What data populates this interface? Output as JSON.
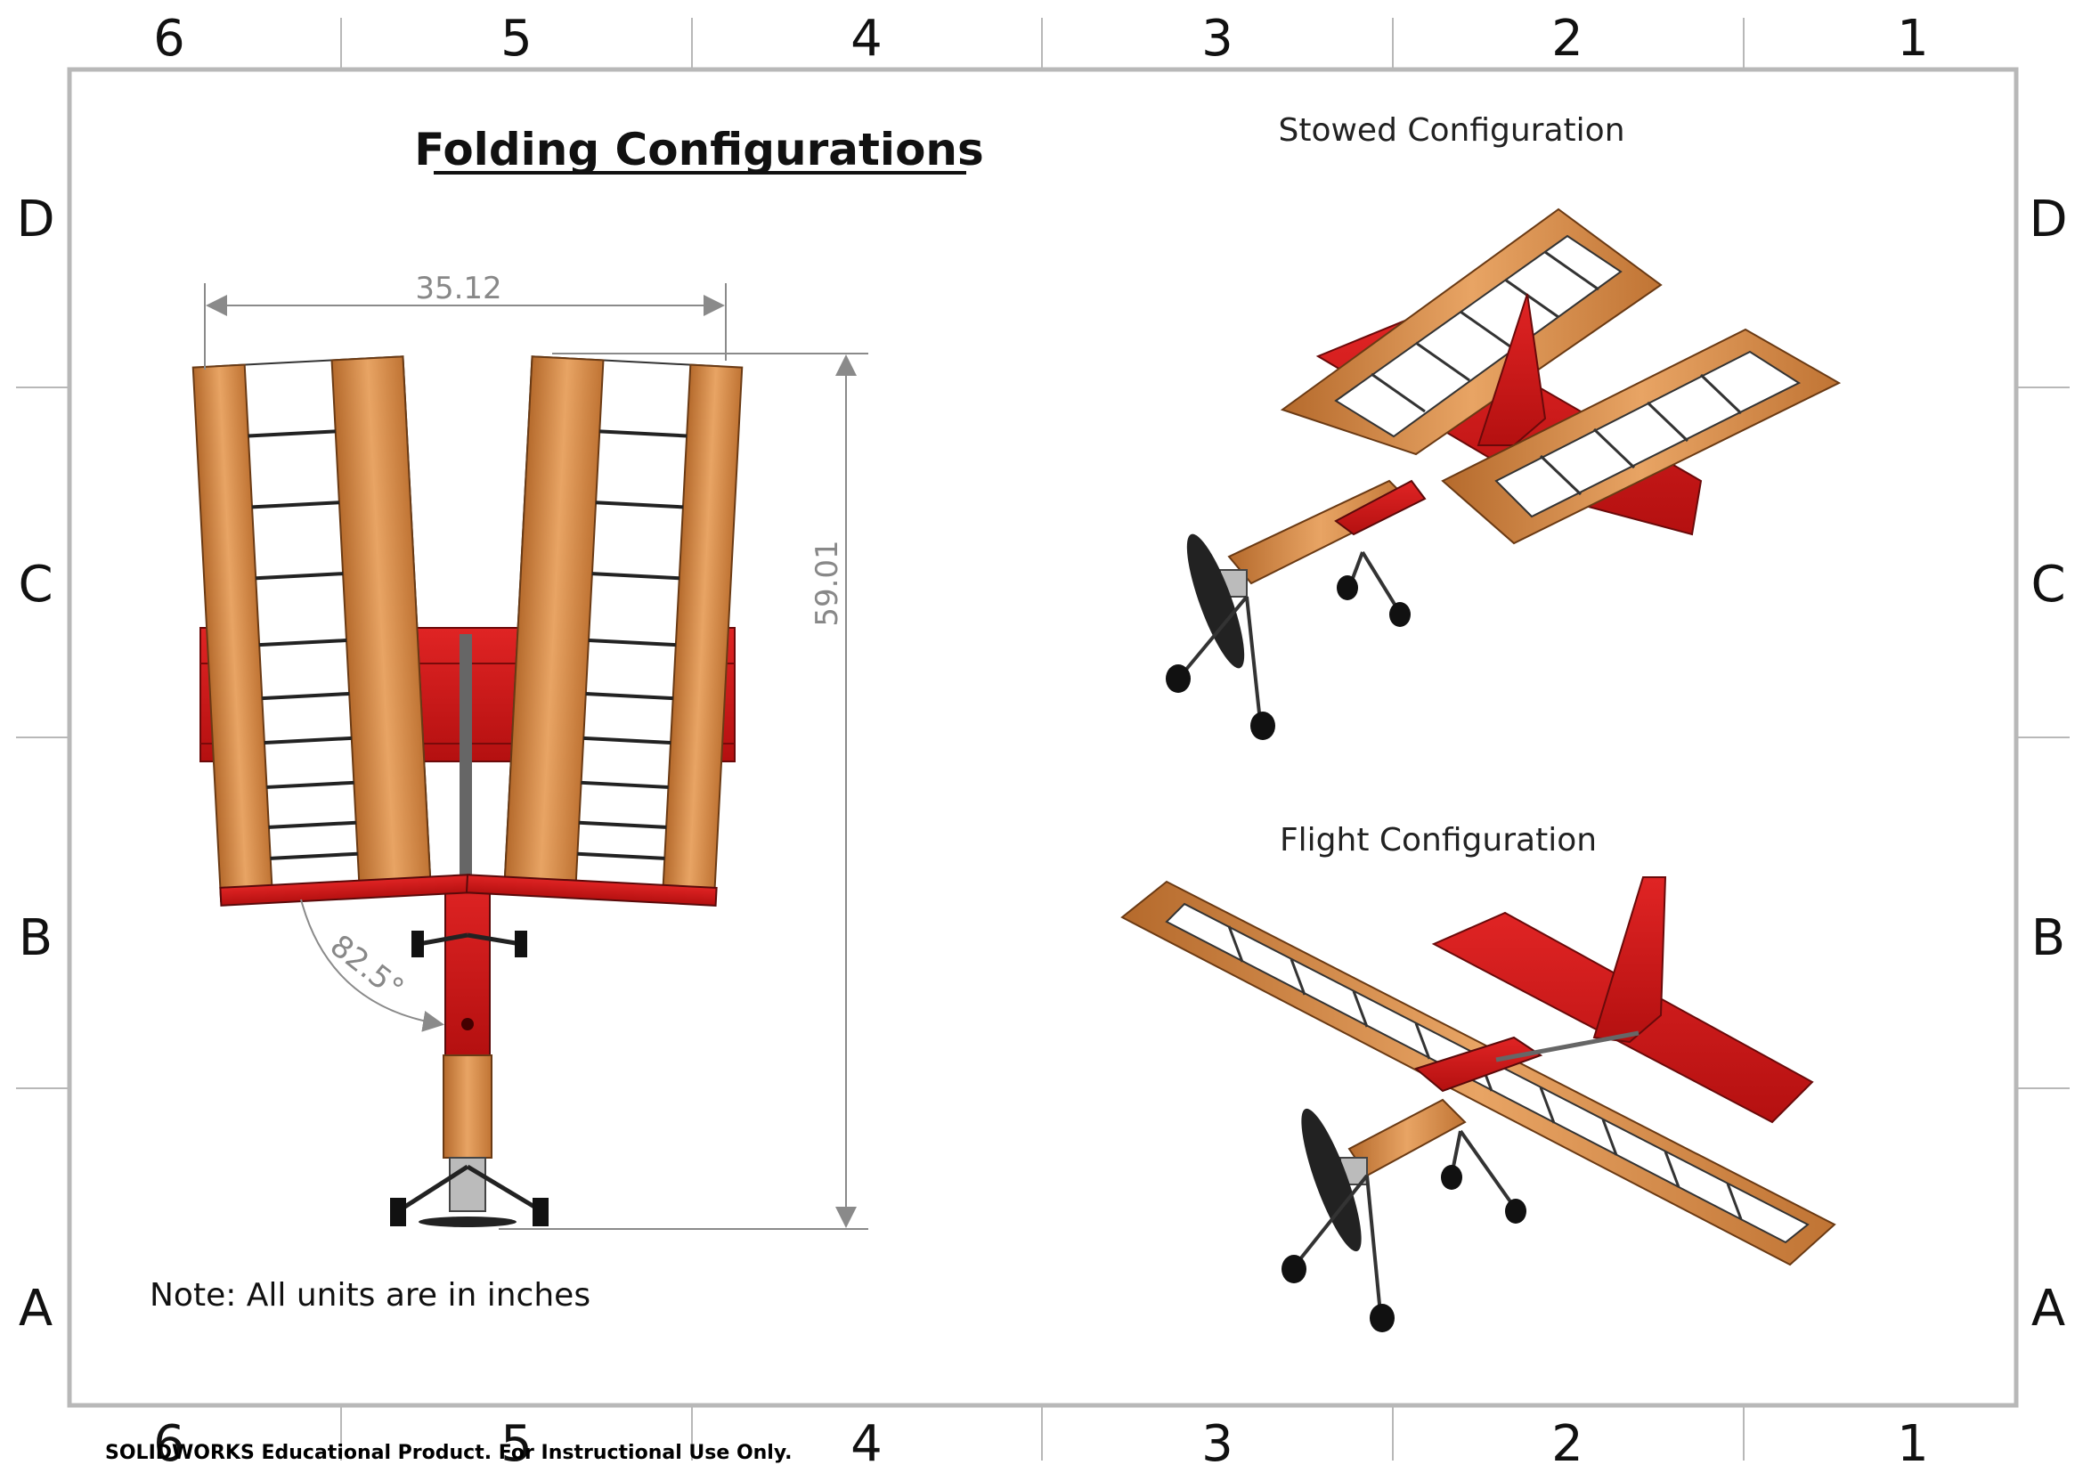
{
  "title": "Folding Configurations",
  "note": "Note: All units are in inches",
  "views": {
    "stowed_label": "Stowed Configuration",
    "flight_label": "Flight Configuration"
  },
  "dimensions": {
    "width": "35.12",
    "length": "59.01",
    "angle": "82.5°"
  },
  "zones": {
    "columns": [
      "6",
      "5",
      "4",
      "3",
      "2",
      "1"
    ],
    "rows": [
      "D",
      "C",
      "B",
      "A"
    ]
  },
  "footer": "SOLIDWORKS Educational Product. For Instructional Use Only.",
  "colors": {
    "wood": "#d98c4a",
    "wood_dark": "#a8612a",
    "red": "#d81a1a",
    "red_dark": "#8e0c0c",
    "border": "#b8b8b8",
    "dim_line": "#8a8a8a"
  }
}
